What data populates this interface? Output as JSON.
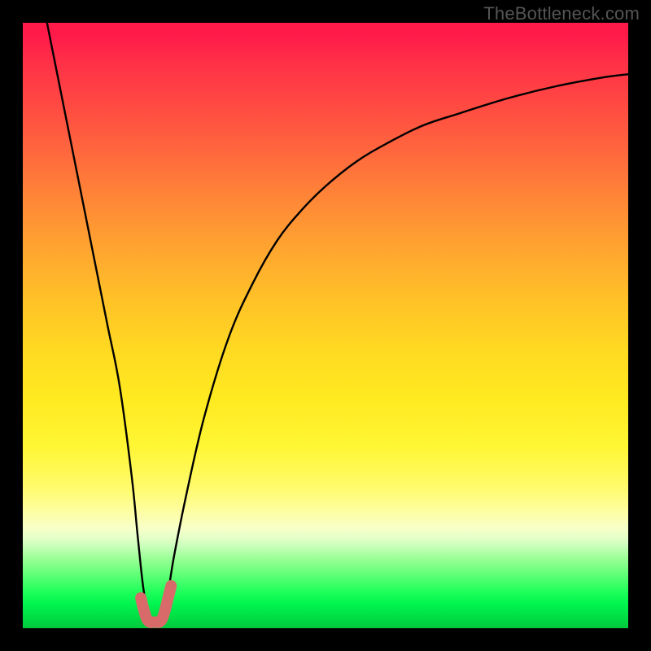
{
  "watermark": "TheBottleneck.com",
  "chart_data": {
    "type": "line",
    "title": "",
    "xlabel": "",
    "ylabel": "",
    "xlim": [
      0,
      100
    ],
    "ylim": [
      0,
      100
    ],
    "grid": false,
    "legend": false,
    "background_gradient": {
      "from": "#ff1a4a",
      "to": "#00c93d",
      "direction": "top-to-bottom",
      "meaning": "red=high, green=low"
    },
    "series": [
      {
        "name": "main-curve",
        "color": "#000000",
        "x": [
          4,
          6,
          8,
          10,
          12,
          14,
          16,
          18,
          19,
          20,
          21,
          22,
          23,
          24,
          25,
          27,
          30,
          34,
          38,
          42,
          46,
          50,
          55,
          60,
          66,
          72,
          80,
          88,
          96,
          100
        ],
        "y": [
          100,
          90,
          80,
          70,
          60,
          50,
          40,
          25,
          15,
          6,
          2,
          1,
          2,
          6,
          12,
          22,
          35,
          48,
          57,
          64,
          69,
          73,
          77,
          80,
          83,
          85,
          87.5,
          89.5,
          91,
          91.5
        ]
      },
      {
        "name": "minimum-highlight",
        "color": "#d86a6a",
        "x": [
          19.5,
          20,
          20.5,
          21,
          21.5,
          22,
          22.5,
          23,
          23.5,
          24,
          24.5
        ],
        "y": [
          5,
          3,
          1.5,
          1,
          1,
          1,
          1,
          1.5,
          3,
          5,
          7
        ]
      }
    ],
    "annotations": []
  },
  "colors": {
    "frame": "#000000",
    "watermark": "#555555",
    "curve": "#000000",
    "highlight": "#d86a6a"
  }
}
